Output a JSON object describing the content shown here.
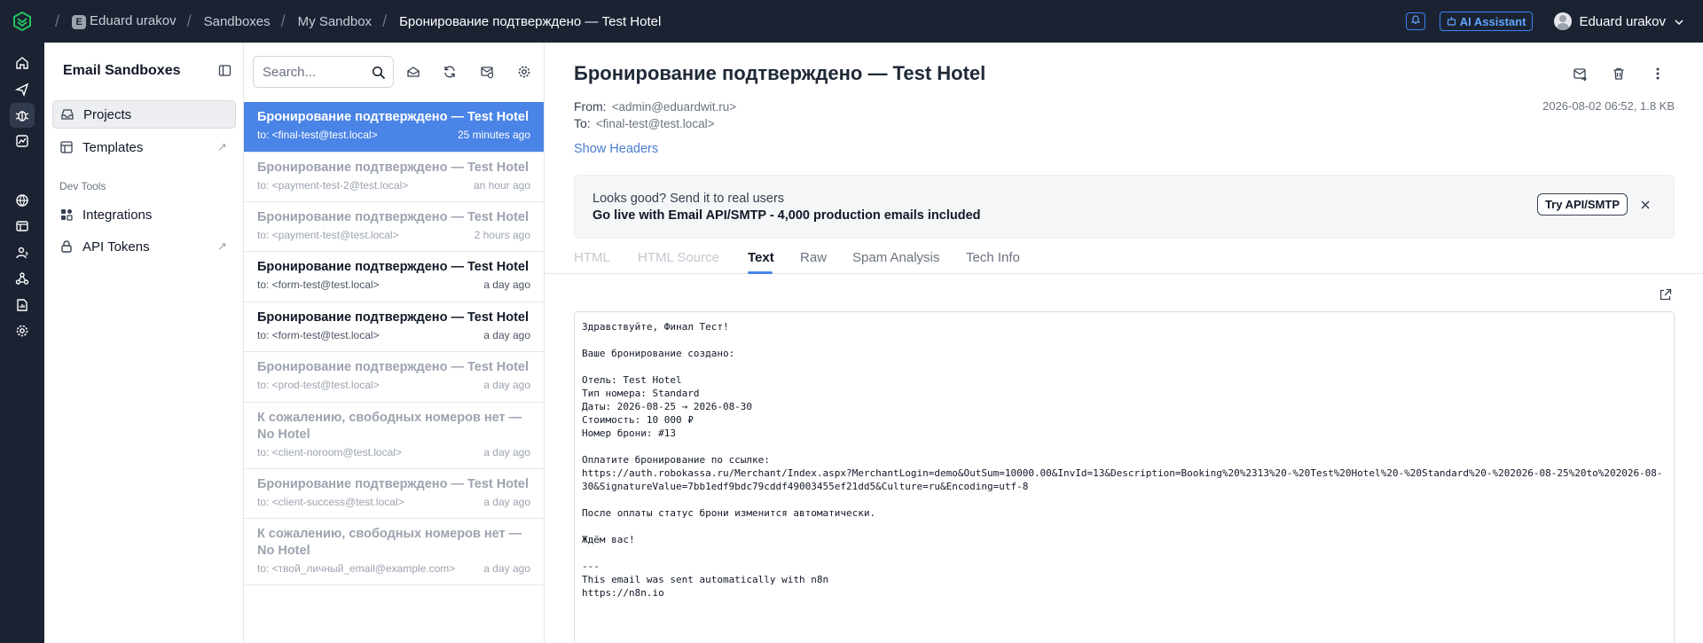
{
  "breadcrumb": {
    "workspace_initial": "E",
    "workspace": "Eduard urakov",
    "section": "Sandboxes",
    "sandbox": "My Sandbox",
    "current": "Бронирование подтверждено — Test Hotel"
  },
  "topbar": {
    "ai_assistant_label": "AI Assistant",
    "user_name": "Eduard urakov",
    "accent_color": "#3b82f6"
  },
  "rail": {
    "icons": [
      "home-icon",
      "send-icon",
      "bug-icon",
      "chart-icon",
      "globe-icon",
      "layout-icon",
      "users-icon",
      "webhook-icon",
      "report-icon",
      "settings-icon"
    ]
  },
  "sidebar": {
    "title": "Email Sandboxes",
    "items": [
      {
        "label": "Projects",
        "icon": "inbox-icon"
      },
      {
        "label": "Templates",
        "icon": "template-icon"
      }
    ],
    "dev_tools_label": "Dev Tools",
    "dev_items": [
      {
        "label": "Integrations",
        "icon": "integrations-icon"
      },
      {
        "label": "API Tokens",
        "icon": "lock-icon"
      }
    ]
  },
  "list": {
    "search_placeholder": "Search...",
    "emails": [
      {
        "subject": "Бронирование подтверждено — Test Hotel",
        "to": "to: <final-test@test.local>",
        "time": "25 minutes ago",
        "state": "selected"
      },
      {
        "subject": "Бронирование подтверждено — Test Hotel",
        "to": "to: <payment-test-2@test.local>",
        "time": "an hour ago",
        "state": "read"
      },
      {
        "subject": "Бронирование подтверждено — Test Hotel",
        "to": "to: <payment-test@test.local>",
        "time": "2 hours ago",
        "state": "read"
      },
      {
        "subject": "Бронирование подтверждено — Test Hotel",
        "to": "to: <form-test@test.local>",
        "time": "a day ago",
        "state": "unread"
      },
      {
        "subject": "Бронирование подтверждено — Test Hotel",
        "to": "to: <form-test@test.local>",
        "time": "a day ago",
        "state": "unread"
      },
      {
        "subject": "Бронирование подтверждено — Test Hotel",
        "to": "to: <prod-test@test.local>",
        "time": "a day ago",
        "state": "read"
      },
      {
        "subject": "К сожалению, свободных номеров нет — No Hotel",
        "to": "to: <client-noroom@test.local>",
        "time": "a day ago",
        "state": "read"
      },
      {
        "subject": "Бронирование подтверждено — Test Hotel",
        "to": "to: <client-success@test.local>",
        "time": "a day ago",
        "state": "read"
      },
      {
        "subject": "К сожалению, свободных номеров нет — No Hotel",
        "to": "to: <твой_личный_email@example.com>",
        "time": "a day ago",
        "state": "read"
      }
    ]
  },
  "message": {
    "subject": "Бронирование подтверждено — Test Hotel",
    "from_label": "From:",
    "from": "<admin@eduardwit.ru>",
    "to_label": "To:",
    "to": "<final-test@test.local>",
    "date_size": "2026-08-02 06:52, 1.8 KB",
    "show_headers": "Show Headers",
    "promo_line1": "Looks good? Send it to real users",
    "promo_line2": "Go live with Email API/SMTP - 4,000 production emails included",
    "promo_button": "Try API/SMTP",
    "tabs": [
      "HTML",
      "HTML Source",
      "Text",
      "Raw",
      "Spam Analysis",
      "Tech Info"
    ],
    "active_tab": "Text",
    "body_text": "Здравствуйте, Финал Тест!\n\nВаше бронирование создано:\n\nОтель: Test Hotel\nТип номера: Standard\nДаты: 2026-08-25 → 2026-08-30\nСтоимость: 10 000 ₽\nНомер брони: #13\n\nОплатите бронирование по ссылке:\nhttps://auth.robokassa.ru/Merchant/Index.aspx?MerchantLogin=demo&OutSum=10000.00&InvId=13&Description=Booking%20%2313%20-%20Test%20Hotel%20-%20Standard%20-%202026-08-25%20to%202026-08-30&SignatureValue=7bb1edf9bdc79cddf49003455ef21dd5&Culture=ru&Encoding=utf-8\n\nПосле оплаты статус брони изменится автоматически.\n\nЖдём вас!\n\n---\nThis email was sent automatically with n8n\nhttps://n8n.io"
  }
}
